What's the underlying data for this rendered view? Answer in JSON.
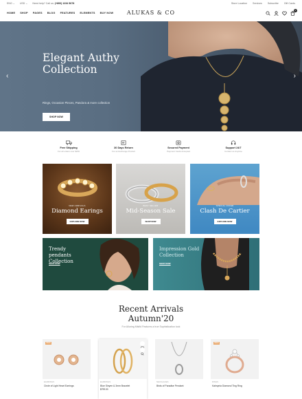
{
  "topbar": {
    "currency": "ENG ⌄",
    "lang": "USD ⌄",
    "help_prefix": "Need help? Call us:",
    "phone": "(+800) 1234 5678",
    "links": [
      "Store Location",
      "Services",
      "Subscribe",
      "Gift Cards"
    ]
  },
  "header": {
    "nav": [
      "HOME",
      "SHOP",
      "PAGES",
      "BLOG",
      "FEATURES",
      "ELEMENTS",
      "BUY NOW"
    ],
    "logo": "ALUKAS & CO",
    "cart_count": "0"
  },
  "hero": {
    "title": "Elegant Authy Collection",
    "subtitle": "Rings, Occasion Pieces, Pandora & more collection",
    "button": "SHOP NOW",
    "slide_index": 0,
    "slide_count": 3
  },
  "features": [
    {
      "title": "Free Shipping",
      "sub": "For all orders over $200",
      "icon": "truck-icon"
    },
    {
      "title": "30 Days Return",
      "sub": "For an Exchange Product",
      "icon": "return-icon"
    },
    {
      "title": "Secured Payment",
      "sub": "Payment Cards Accepted",
      "icon": "card-icon"
    },
    {
      "title": "Support 24/7",
      "sub": "Contact us Anytime",
      "icon": "support-icon"
    }
  ],
  "tiles": [
    {
      "caption": "NEW ARRIVALS",
      "name": "Diamond Earings",
      "button": "EXPLORE NOW"
    },
    {
      "caption": "BEST SELLER",
      "name": "Mid-Season Sale",
      "button": "SHOP NOW"
    },
    {
      "caption": "SPECIAL OFFER",
      "name": "Clash De Cartier",
      "button": "EXPLORE NOW"
    }
  ],
  "banners": [
    {
      "title": "Trendy pendants Collection",
      "link": "SHOP NOW"
    },
    {
      "title": "Impression Gold Collection",
      "link": "SHOP NOW"
    }
  ],
  "recent": {
    "title_line1": "Recent Arrivals",
    "title_line2": "Autumn'20",
    "subtitle": "For Alluring Misfid Features a true Sophistication look"
  },
  "products": [
    {
      "category": "EARRINGS",
      "name": "Circle of Light Heart Earrings",
      "price": "",
      "sale": "SALE"
    },
    {
      "category": "EARRINGS",
      "name": "Blue Sinyen & 3mm Bracelet",
      "price": "$799.00",
      "sale": ""
    },
    {
      "category": "NECKLACES",
      "name": "Birds of Paradise Pendant",
      "price": "",
      "sale": ""
    },
    {
      "category": "RINGS",
      "name": "Kalmynia Diamond Ting Ring",
      "price": "",
      "sale": "SALE"
    }
  ],
  "colors": {
    "accent": "#e9a86c",
    "hero_bg": "#5a6e82",
    "banner_green": "#1f4a3e",
    "banner_teal": "#2f6f77"
  }
}
